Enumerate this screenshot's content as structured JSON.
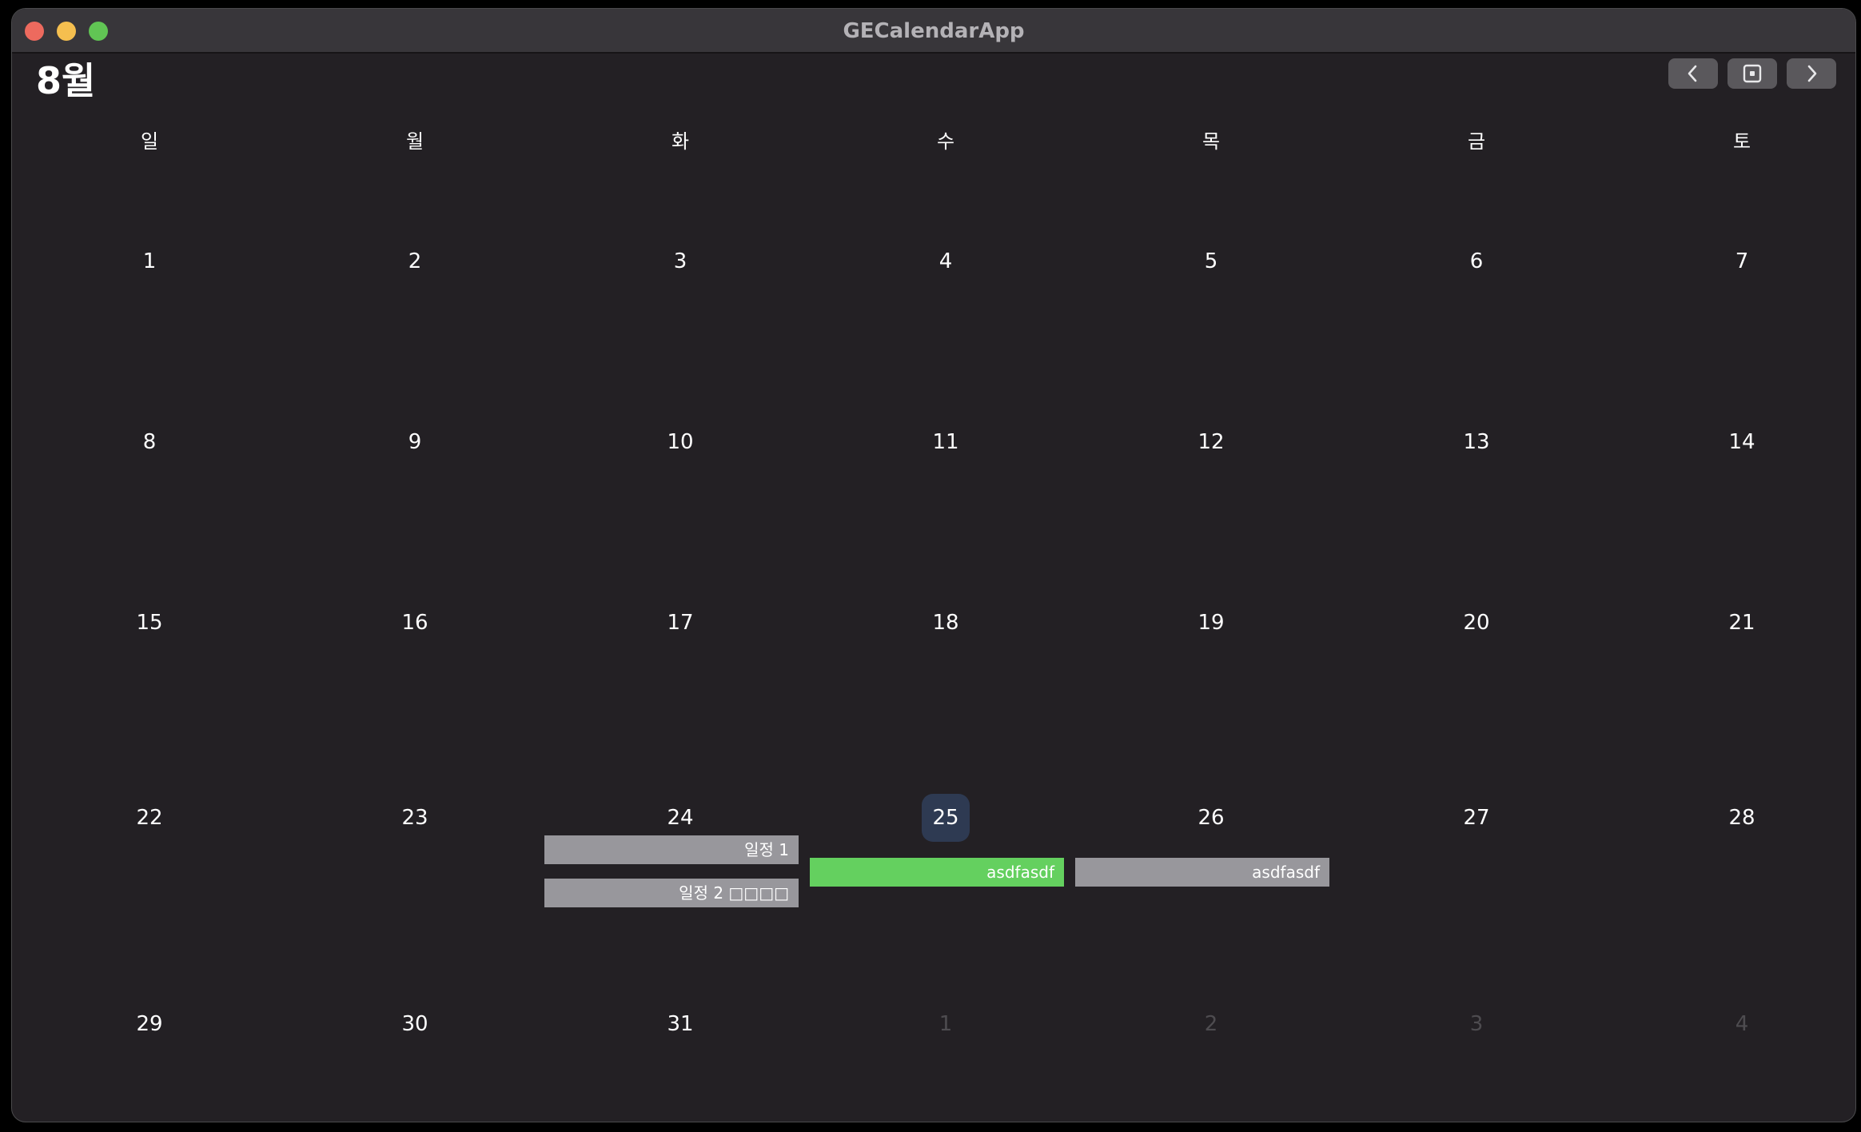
{
  "window": {
    "title": "GECalendarApp"
  },
  "header": {
    "month_title": "8월"
  },
  "weekdays": [
    "일",
    "월",
    "화",
    "수",
    "목",
    "금",
    "토"
  ],
  "weeks": [
    [
      "1",
      "2",
      "3",
      "4",
      "5",
      "6",
      "7"
    ],
    [
      "8",
      "9",
      "10",
      "11",
      "12",
      "13",
      "14"
    ],
    [
      "15",
      "16",
      "17",
      "18",
      "19",
      "20",
      "21"
    ],
    [
      "22",
      "23",
      "24",
      "25",
      "26",
      "27",
      "28"
    ],
    [
      "29",
      "30",
      "31",
      "1",
      "2",
      "3",
      "4"
    ]
  ],
  "today": "25",
  "events": [
    {
      "title": "일정 1",
      "color": "#98979c"
    },
    {
      "title": "일정 2 □□□□",
      "color": "#98979c"
    },
    {
      "title": "asdfasdf",
      "color": "#64d05f"
    },
    {
      "title": "asdfasdf",
      "color": "#98979c"
    }
  ],
  "icons": {
    "prev": "chevron-left-icon",
    "today": "square-dot-icon",
    "next": "chevron-right-icon"
  },
  "colors": {
    "window_bg": "#232024",
    "titlebar_bg": "#38363a",
    "today_highlight": "#2e3a52",
    "button_bg": "#5a585c",
    "close": "#ed6a5e",
    "minimize": "#f5bf4f",
    "maximize": "#61c554"
  }
}
